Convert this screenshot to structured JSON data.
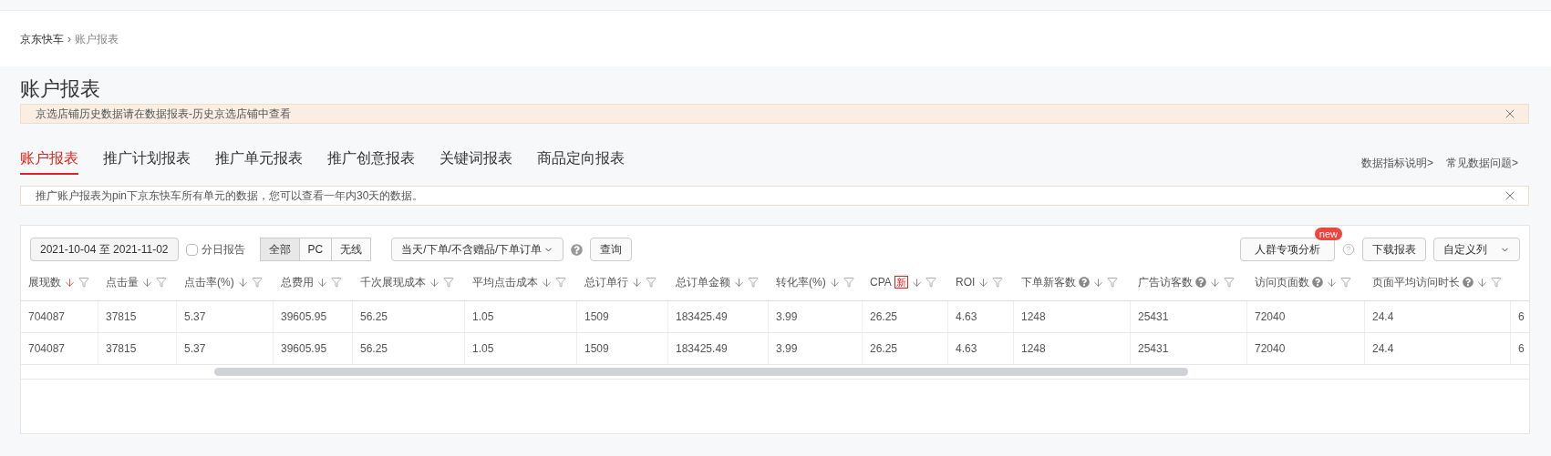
{
  "breadcrumb": {
    "items": [
      "京东快车",
      "账户报表"
    ],
    "separator": "›"
  },
  "page_title": "账户报表",
  "notice": {
    "text": "京选店铺历史数据请在数据报表-历史京选店铺中查看"
  },
  "tabs": [
    {
      "label": "账户报表",
      "selected": true
    },
    {
      "label": "推广计划报表",
      "selected": false
    },
    {
      "label": "推广单元报表",
      "selected": false
    },
    {
      "label": "推广创意报表",
      "selected": false
    },
    {
      "label": "关键词报表",
      "selected": false
    },
    {
      "label": "商品定向报表",
      "selected": false
    }
  ],
  "help_links": [
    "数据指标说明>",
    "常见数据问题>"
  ],
  "info_bar": {
    "text": "推广账户报表为pin下京东快车所有单元的数据，您可以查看一年内30天的数据。"
  },
  "toolbar": {
    "date_range": "2021-10-04 至 2021-11-02",
    "daily_report": {
      "label": "分日报告",
      "checked": false
    },
    "segments": [
      {
        "label": "全部",
        "selected": true
      },
      {
        "label": "PC",
        "selected": false
      },
      {
        "label": "无线",
        "selected": false
      }
    ],
    "order_type": "当天/下单/不含赠品/下单订单",
    "query_button": "查询",
    "crowd_button": {
      "label": "人群专项分析",
      "badge": "new"
    },
    "download_button": "下载报表",
    "custom_columns": "自定义列"
  },
  "table": {
    "columns": [
      {
        "label": "展现数",
        "sorted": true,
        "help": false
      },
      {
        "label": "点击量",
        "sorted": false,
        "help": false
      },
      {
        "label": "点击率(%)",
        "sorted": false,
        "help": false
      },
      {
        "label": "总费用",
        "sorted": false,
        "help": false
      },
      {
        "label": "千次展现成本",
        "sorted": false,
        "help": false
      },
      {
        "label": "平均点击成本",
        "sorted": false,
        "help": false
      },
      {
        "label": "总订单行",
        "sorted": false,
        "help": false
      },
      {
        "label": "总订单金额",
        "sorted": false,
        "help": false
      },
      {
        "label": "转化率(%)",
        "sorted": false,
        "help": false
      },
      {
        "label": "CPA",
        "badge": "新",
        "sorted": false,
        "help": false
      },
      {
        "label": "ROI",
        "sorted": false,
        "help": false
      },
      {
        "label": "下单新客数",
        "sorted": false,
        "help": true
      },
      {
        "label": "广告访客数",
        "sorted": false,
        "help": true
      },
      {
        "label": "访问页面数",
        "sorted": false,
        "help": true
      },
      {
        "label": "页面平均访问时长",
        "sorted": false,
        "help": true
      }
    ],
    "rows": [
      [
        "704087",
        "37815",
        "5.37",
        "39605.95",
        "56.25",
        "1.05",
        "1509",
        "183425.49",
        "3.99",
        "26.25",
        "4.63",
        "1248",
        "25431",
        "72040",
        "24.4",
        "6"
      ],
      [
        "704087",
        "37815",
        "5.37",
        "39605.95",
        "56.25",
        "1.05",
        "1509",
        "183425.49",
        "3.99",
        "26.25",
        "4.63",
        "1248",
        "25431",
        "72040",
        "24.4",
        "6"
      ]
    ]
  }
}
